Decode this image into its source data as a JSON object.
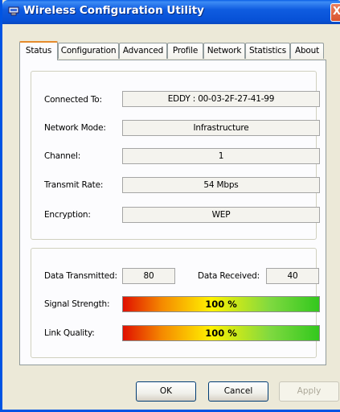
{
  "window": {
    "title": "Wireless Configuration Utility",
    "close_symbol": "X"
  },
  "tabs": [
    {
      "label": "Status",
      "active": true
    },
    {
      "label": "Configuration",
      "active": false
    },
    {
      "label": "Advanced",
      "active": false
    },
    {
      "label": "Profile",
      "active": false
    },
    {
      "label": "Network",
      "active": false
    },
    {
      "label": "Statistics",
      "active": false
    },
    {
      "label": "About",
      "active": false
    }
  ],
  "status": {
    "connected_to": {
      "label": "Connected To:",
      "value": "EDDY : 00-03-2F-27-41-99"
    },
    "network_mode": {
      "label": "Network Mode:",
      "value": "Infrastructure"
    },
    "channel": {
      "label": "Channel:",
      "value": "1"
    },
    "transmit_rate": {
      "label": "Transmit Rate:",
      "value": "54 Mbps"
    },
    "encryption": {
      "label": "Encryption:",
      "value": "WEP"
    }
  },
  "traffic": {
    "transmitted": {
      "label": "Data Transmitted:",
      "value": "80"
    },
    "received": {
      "label": "Data Received:",
      "value": "40"
    }
  },
  "quality": {
    "signal": {
      "label": "Signal Strength:",
      "text": "100 %",
      "level": 100
    },
    "link": {
      "label": "Link Quality:",
      "text": "100 %",
      "level": 100
    }
  },
  "buttons": {
    "ok": "OK",
    "cancel": "Cancel",
    "apply": "Apply"
  },
  "colors": {
    "title_bar": "#0751d6",
    "active_tab_accent": "#e68b2c",
    "bar_start": "#e01000",
    "bar_mid": "#fff200",
    "bar_end": "#33c81e"
  }
}
